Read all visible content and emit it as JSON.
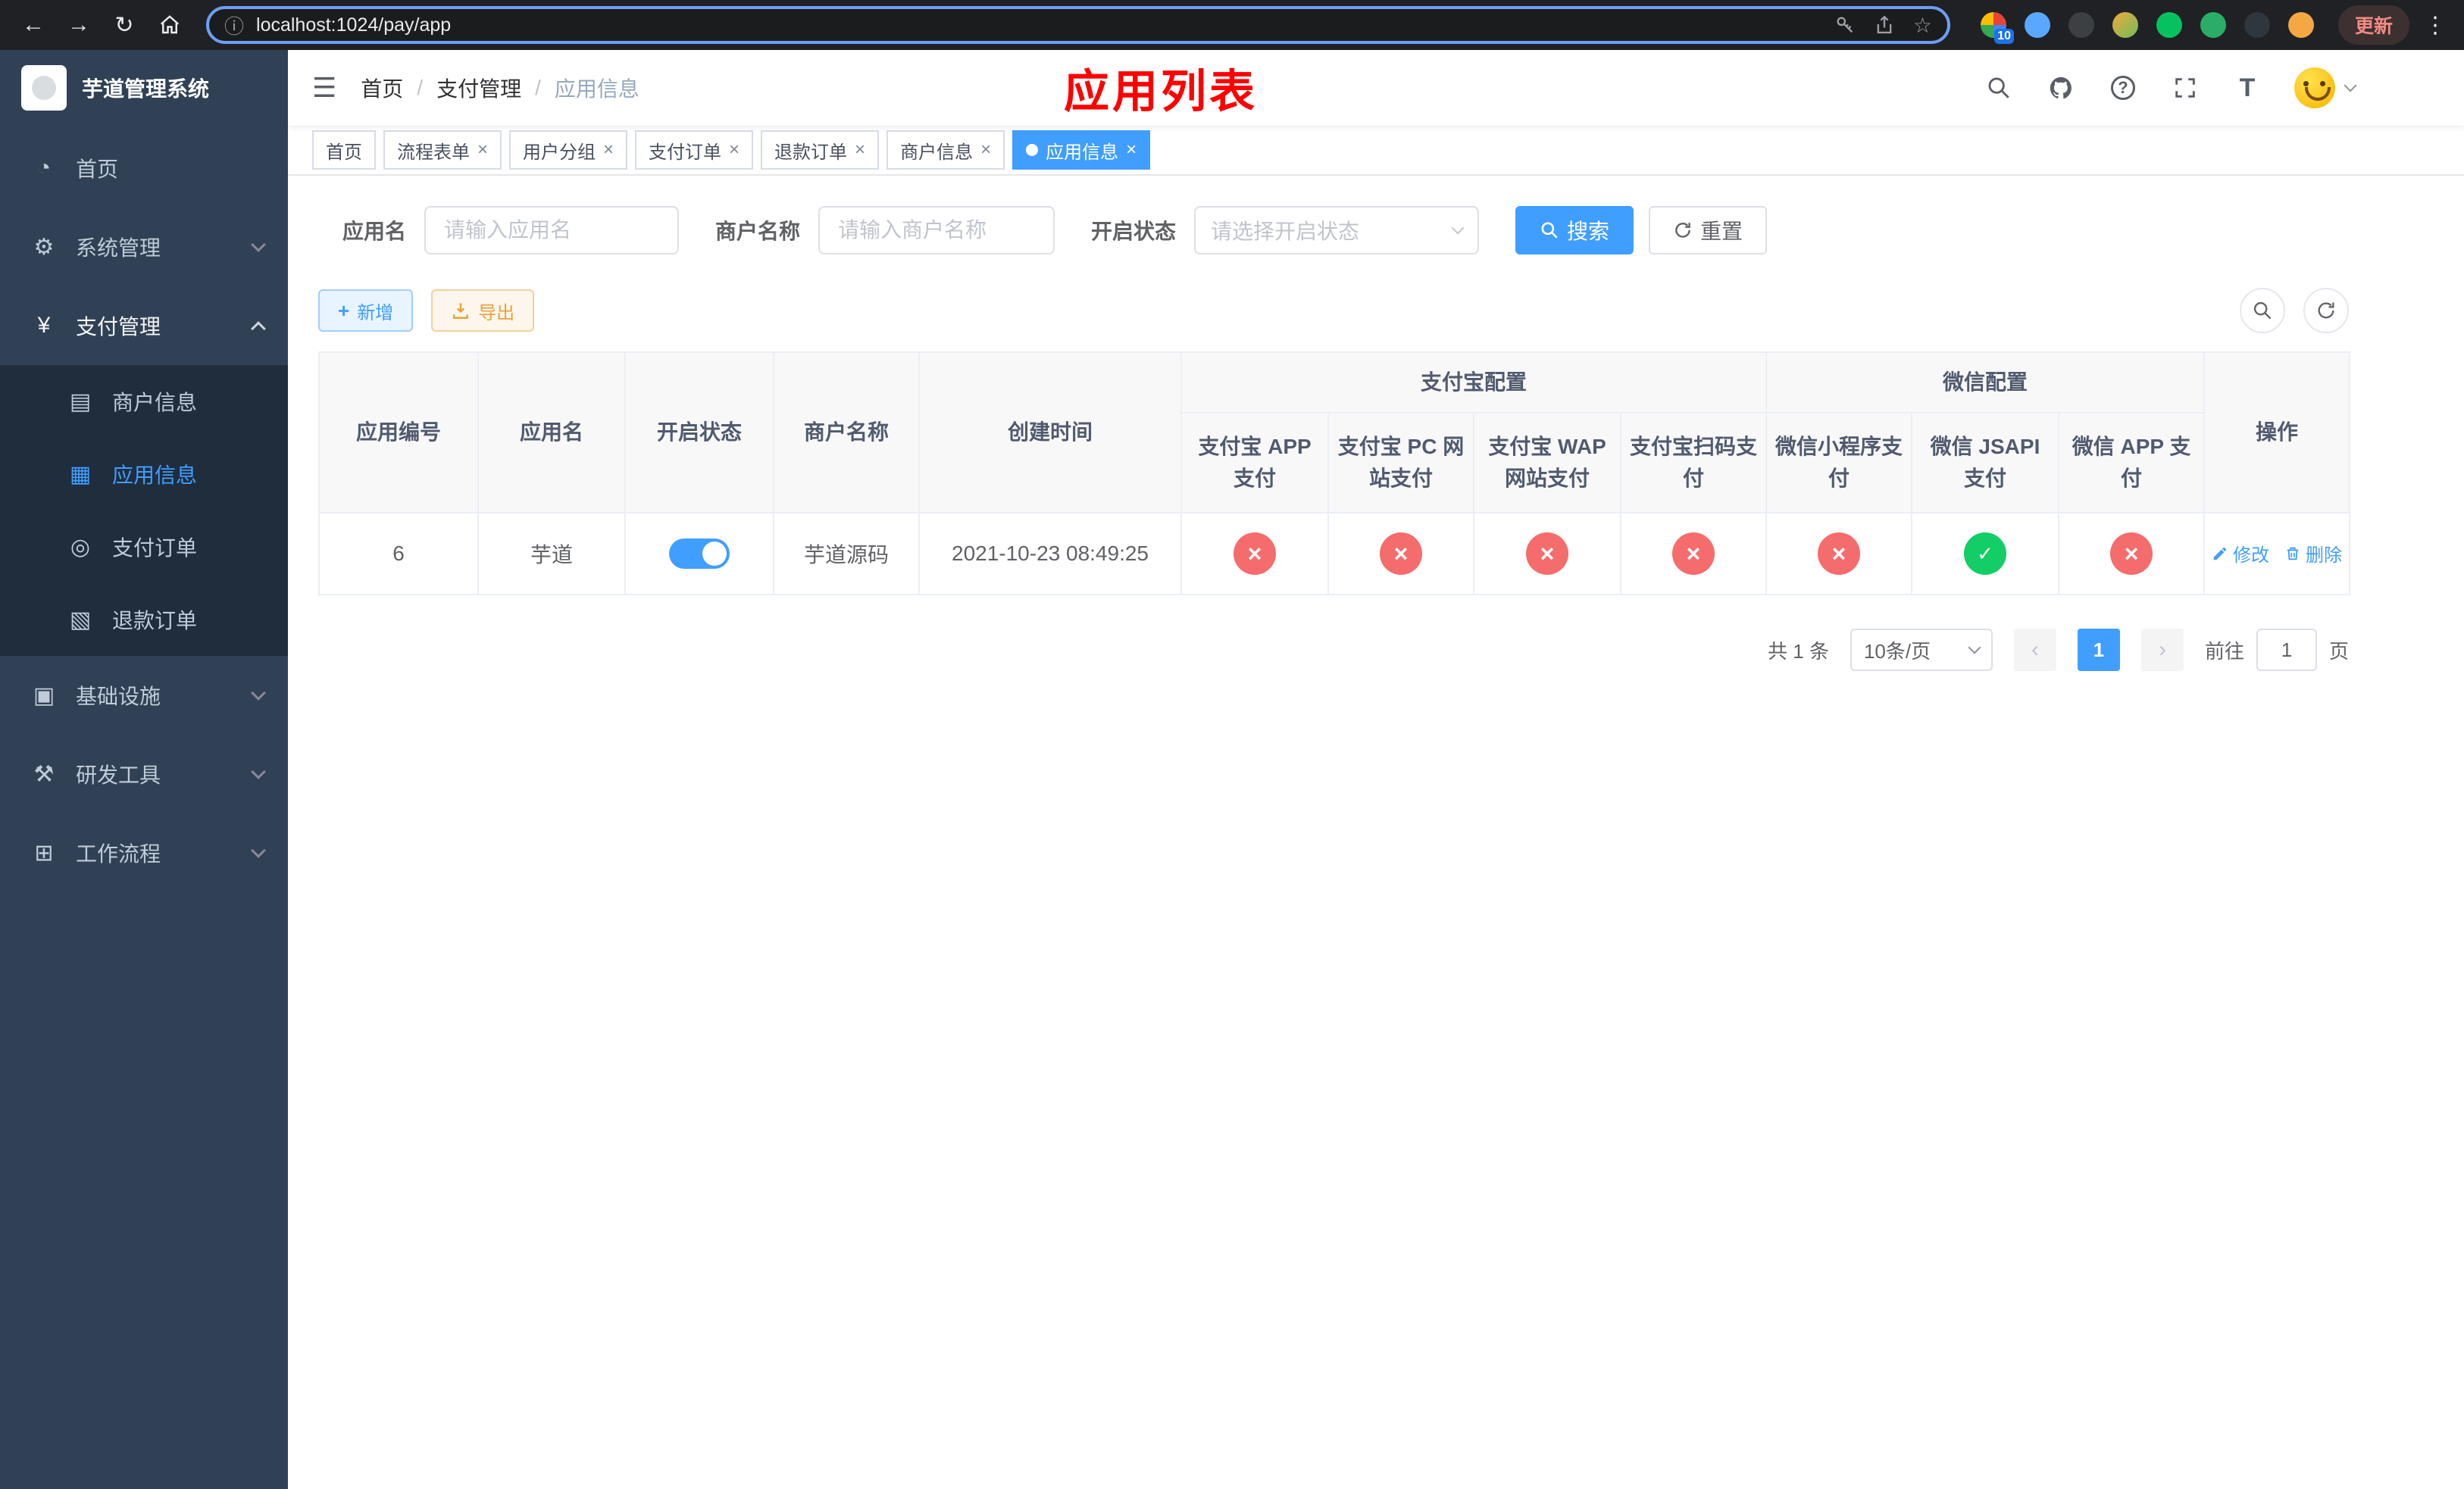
{
  "browser": {
    "url": "localhost:1024/pay/app",
    "update_label": "更新",
    "ext_badge": "10"
  },
  "icons": {
    "back": "←",
    "forward": "→",
    "reload": "↻",
    "info": "ⓘ",
    "star": "☆",
    "kebab": "⋮",
    "hamburger": "☰",
    "fontsize": "T",
    "question": "?",
    "dashboard": "◔",
    "gear": "⚙",
    "yen": "¥",
    "merchant": "▤",
    "app_grid": "▦",
    "order": "◎",
    "refund": "▧",
    "infra": "▣",
    "tools": "⚒",
    "workflow": "⊞",
    "plus": "+"
  },
  "sidebar": {
    "title": "芋道管理系统",
    "items": [
      {
        "label": "首页"
      },
      {
        "label": "系统管理"
      },
      {
        "label": "支付管理"
      },
      {
        "label": "基础设施"
      },
      {
        "label": "研发工具"
      },
      {
        "label": "工作流程"
      }
    ],
    "pay_children": [
      {
        "label": "商户信息"
      },
      {
        "label": "应用信息"
      },
      {
        "label": "支付订单"
      },
      {
        "label": "退款订单"
      }
    ]
  },
  "header": {
    "breadcrumb": [
      "首页",
      "支付管理",
      "应用信息"
    ],
    "annotation": "应用列表"
  },
  "tabs": [
    {
      "label": "首页"
    },
    {
      "label": "流程表单"
    },
    {
      "label": "用户分组"
    },
    {
      "label": "支付订单"
    },
    {
      "label": "退款订单"
    },
    {
      "label": "商户信息"
    },
    {
      "label": "应用信息"
    }
  ],
  "filters": {
    "app_name_label": "应用名",
    "app_name_placeholder": "请输入应用名",
    "merchant_label": "商户名称",
    "merchant_placeholder": "请输入商户名称",
    "status_label": "开启状态",
    "status_placeholder": "请选择开启状态",
    "search_label": "搜索",
    "reset_label": "重置"
  },
  "toolbar": {
    "add_label": "新增",
    "export_label": "导出"
  },
  "table": {
    "group_alipay": "支付宝配置",
    "group_wechat": "微信配置",
    "columns_simple": [
      "应用编号",
      "应用名",
      "开启状态",
      "商户名称",
      "创建时间"
    ],
    "alipay_sub": [
      "支付宝 APP 支付",
      "支付宝 PC 网站支付",
      "支付宝 WAP 网站支付",
      "支付宝扫码支付"
    ],
    "wechat_sub": [
      "微信小程序支付",
      "微信 JSAPI 支付",
      "微信 APP 支付"
    ],
    "column_op": "操作",
    "rows": [
      {
        "app_id": "6",
        "app_name": "芋道",
        "enabled": "on",
        "merchant_name": "芋道源码",
        "create_time": "2021-10-23 08:49:25",
        "statuses": [
          "no",
          "no",
          "no",
          "no",
          "no",
          "yes",
          "no"
        ],
        "edit_label": "修改",
        "delete_label": "删除"
      }
    ]
  },
  "pagination": {
    "total_text": "共 1 条",
    "page_size": "10条/页",
    "current_page": "1",
    "goto_prefix": "前往",
    "goto_value": "1",
    "goto_suffix": "页"
  },
  "colors": {
    "primary": "#409eff",
    "danger": "#f56c6c",
    "success": "#13ce66",
    "annotation": "#fe0000",
    "sidebar_bg": "#304156",
    "submenu_bg": "#1f2d3d"
  }
}
